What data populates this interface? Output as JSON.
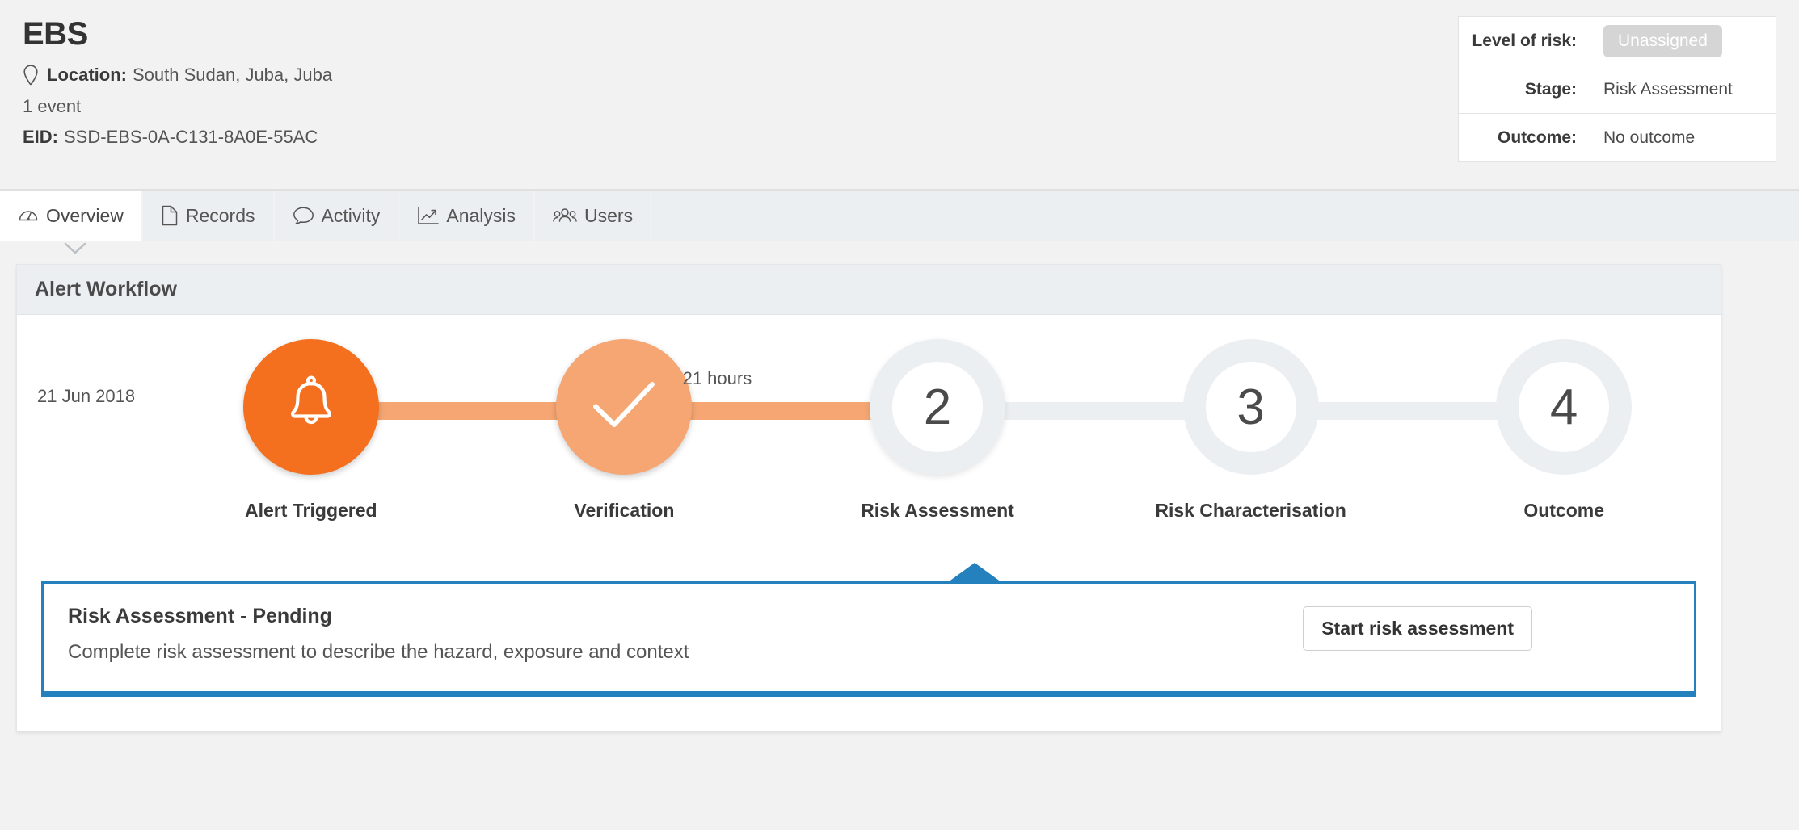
{
  "header": {
    "title": "EBS",
    "location_label": "Location:",
    "location_value": "South Sudan, Juba, Juba",
    "event_count": "1 event",
    "eid_label": "EID:",
    "eid_value": "SSD-EBS-0A-C131-8A0E-55AC",
    "info_rows": [
      {
        "key": "Level of risk:",
        "value": "Unassigned",
        "style": "pill"
      },
      {
        "key": "Stage:",
        "value": "Risk Assessment",
        "style": "plain"
      },
      {
        "key": "Outcome:",
        "value": "No outcome",
        "style": "plain"
      }
    ]
  },
  "tabs": [
    {
      "label": "Overview",
      "icon": "gauge-icon",
      "active": true
    },
    {
      "label": "Records",
      "icon": "file-icon",
      "active": false
    },
    {
      "label": "Activity",
      "icon": "chat-bubble-icon",
      "active": false
    },
    {
      "label": "Analysis",
      "icon": "chart-line-icon",
      "active": false
    },
    {
      "label": "Users",
      "icon": "users-icon",
      "active": false
    }
  ],
  "card": {
    "title": "Alert Workflow",
    "timeline_date": "21 Jun 2018",
    "steps": [
      {
        "label": "Alert Triggered",
        "badge": "bell-icon",
        "state": "complete",
        "duration_to_next": ""
      },
      {
        "label": "Verification",
        "badge": "check-icon",
        "state": "complete",
        "duration_to_next": "21 hours"
      },
      {
        "label": "Risk Assessment",
        "badge": "2",
        "state": "current",
        "duration_to_next": ""
      },
      {
        "label": "Risk Characterisation",
        "badge": "3",
        "state": "pending",
        "duration_to_next": ""
      },
      {
        "label": "Outcome",
        "badge": "4",
        "state": "pending",
        "duration_to_next": ""
      }
    ],
    "callout": {
      "title": "Risk Assessment - Pending",
      "description": "Complete risk assessment to describe the hazard, exposure and context",
      "button_label": "Start risk assessment"
    }
  },
  "colors": {
    "alert_orange": "#f4701f",
    "verified_orange": "#f5a673",
    "pending_gray": "#eceff1",
    "callout_blue": "#2580be",
    "pill_gray": "#d5d5d5"
  }
}
